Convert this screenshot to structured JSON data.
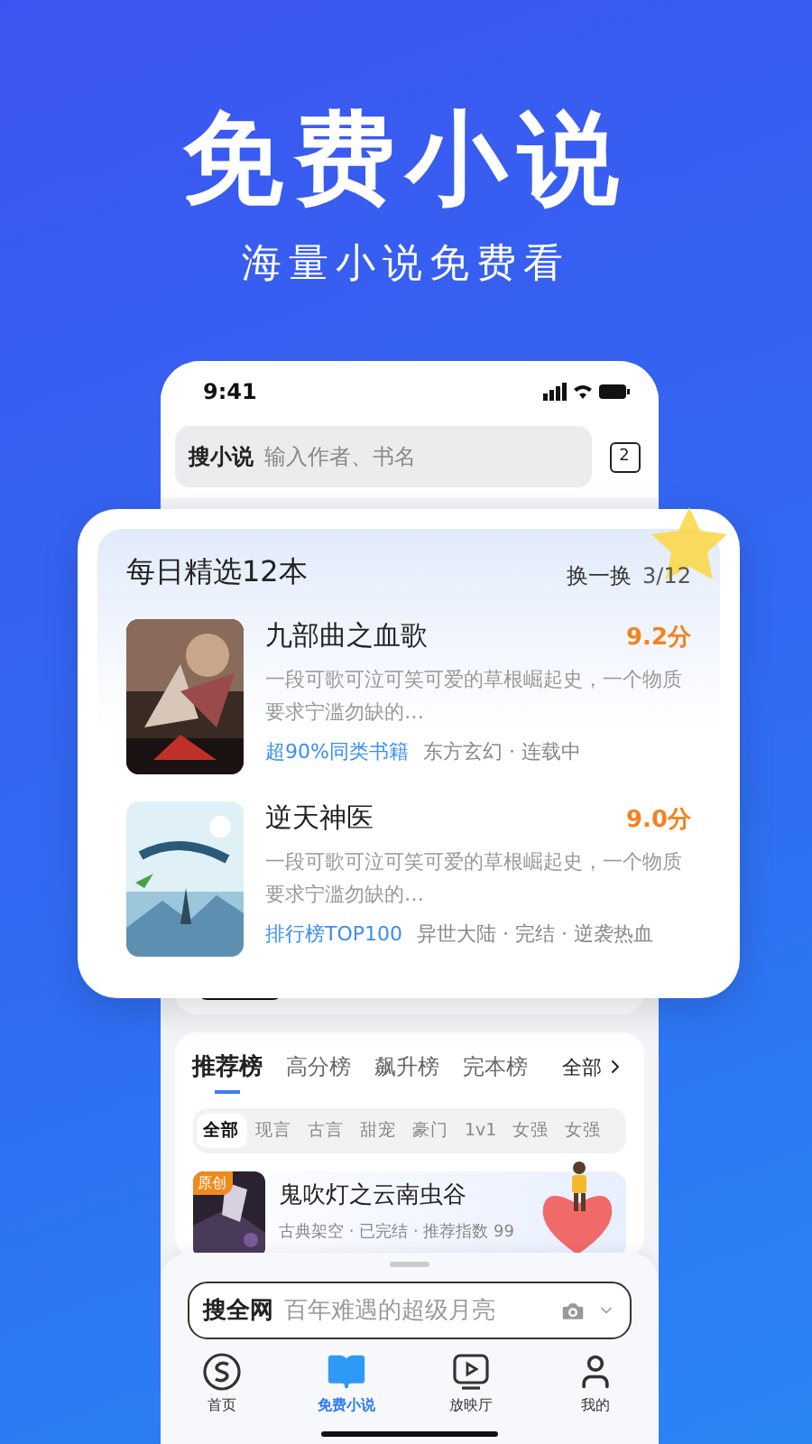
{
  "hero": {
    "title": "免费小说",
    "subtitle": "海量小说免费看"
  },
  "status_bar": {
    "time": "9:41"
  },
  "search": {
    "label": "搜小说",
    "placeholder": "输入作者、书名",
    "tab_count": "2"
  },
  "daily_picks": {
    "title": "每日精选12本",
    "refresh": "换一换",
    "page": "3/12",
    "books": [
      {
        "title": "九部曲之血歌",
        "score": "9.2分",
        "description": "一段可歌可泣可笑可爱的草根崛起史，一个物质要求宁滥勿缺的…",
        "tag": "超90%同类书籍",
        "meta": "东方玄幻 · 连载中"
      },
      {
        "title": "逆天神医",
        "score": "9.0分",
        "description": "一段可歌可泣可笑可爱的草根崛起史，一个物质要求宁滥勿缺的…",
        "tag": "排行榜TOP100",
        "meta": "异世大陆 · 完结 · 逆袭热血"
      }
    ]
  },
  "rankings": {
    "tabs": [
      {
        "label": "推荐榜",
        "selected": true
      },
      {
        "label": "高分榜",
        "selected": false
      },
      {
        "label": "飙升榜",
        "selected": false
      },
      {
        "label": "完本榜",
        "selected": false
      }
    ],
    "all": "全部",
    "chips": [
      {
        "label": "全部",
        "selected": true
      },
      {
        "label": "现言",
        "selected": false
      },
      {
        "label": "古言",
        "selected": false
      },
      {
        "label": "甜宠",
        "selected": false
      },
      {
        "label": "豪门",
        "selected": false
      },
      {
        "label": "1v1",
        "selected": false
      },
      {
        "label": "女强",
        "selected": false
      },
      {
        "label": "女强",
        "selected": false
      }
    ],
    "book": {
      "badge": "原创",
      "title": "鬼吹灯之云南虫谷",
      "meta": "古典架空 · 已完结 · 推荐指数 99"
    }
  },
  "web_search": {
    "label": "搜全网",
    "placeholder": "百年难遇的超级月亮"
  },
  "nav": [
    {
      "label": "首页",
      "selected": false
    },
    {
      "label": "免费小说",
      "selected": true
    },
    {
      "label": "放映厅",
      "selected": false
    },
    {
      "label": "我的",
      "selected": false
    }
  ]
}
